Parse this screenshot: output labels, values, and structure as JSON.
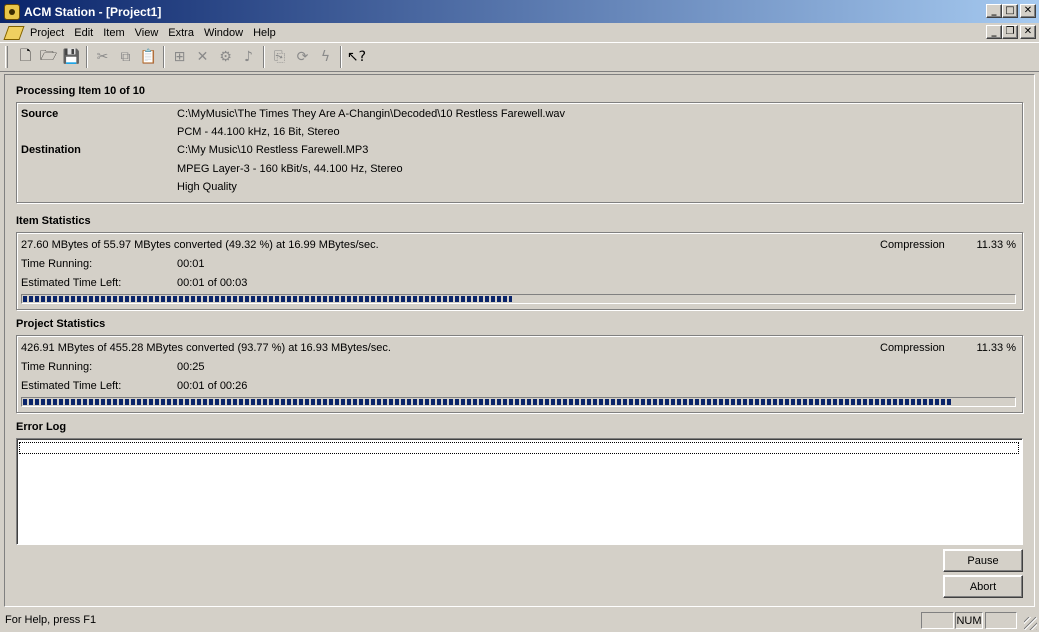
{
  "window": {
    "title": "ACM Station - [Project1]",
    "caption_buttons": {
      "minimize": "_",
      "maximize": "□",
      "close": "✕"
    },
    "mdi_buttons": {
      "minimize": "_",
      "restore": "❐",
      "close": "✕"
    }
  },
  "menu": [
    "Project",
    "Edit",
    "Item",
    "View",
    "Extra",
    "Window",
    "Help"
  ],
  "toolbar": {
    "groups": [
      [
        {
          "icon": "new-file-icon",
          "glyph": "🗋",
          "enabled": true
        },
        {
          "icon": "open-folder-icon",
          "glyph": "🗁",
          "enabled": true
        },
        {
          "icon": "save-disk-icon",
          "glyph": "💾",
          "enabled": true
        }
      ],
      [
        {
          "icon": "cut-icon",
          "glyph": "✂",
          "enabled": false
        },
        {
          "icon": "copy-icon",
          "glyph": "⧉",
          "enabled": false
        },
        {
          "icon": "paste-icon",
          "glyph": "📋",
          "enabled": false
        }
      ],
      [
        {
          "icon": "add-item-icon",
          "glyph": "⊞",
          "enabled": false
        },
        {
          "icon": "delete-icon",
          "glyph": "✕",
          "enabled": false
        },
        {
          "icon": "properties-icon",
          "glyph": "⚙",
          "enabled": false
        },
        {
          "icon": "music-note-icon",
          "glyph": "♪",
          "enabled": false
        }
      ],
      [
        {
          "icon": "copy-settings-icon",
          "glyph": "⎘",
          "enabled": false
        },
        {
          "icon": "convert-icon",
          "glyph": "⟳",
          "enabled": false
        },
        {
          "icon": "lightning-icon",
          "glyph": "ϟ",
          "enabled": false
        }
      ],
      [
        {
          "icon": "context-help-icon",
          "glyph": "↖?",
          "enabled": true
        }
      ]
    ]
  },
  "processing": {
    "heading": "Processing Item 10 of 10",
    "source_label": "Source",
    "source_path": "C:\\MyMusic\\The Times They Are A-Changin\\Decoded\\10 Restless Farewell.wav",
    "source_format": "PCM - 44.100 kHz, 16 Bit, Stereo",
    "destination_label": "Destination",
    "destination_path": "C:\\My Music\\10 Restless Farewell.MP3",
    "destination_format": "MPEG Layer-3 - 160 kBit/s, 44.100 Hz, Stereo",
    "destination_quality": "High Quality"
  },
  "item_stats": {
    "heading": "Item Statistics",
    "converted": "27.60 MBytes of 55.97 MBytes converted (49.32 %) at 16.99 MBytes/sec.",
    "compression_label": "Compression",
    "compression_value": "11.33 %",
    "time_running_label": "Time Running:",
    "time_running": "00:01",
    "eta_label": "Estimated Time Left:",
    "eta": "00:01 of 00:03",
    "progress": 0.4932
  },
  "project_stats": {
    "heading": "Project Statistics",
    "converted": "426.91 MBytes of 455.28 MBytes converted (93.77 %) at 16.93 MBytes/sec.",
    "compression_label": "Compression",
    "compression_value": "11.33 %",
    "time_running_label": "Time Running:",
    "time_running": "00:25",
    "eta_label": "Estimated Time Left:",
    "eta": "00:01 of 00:26",
    "progress": 0.9377
  },
  "error_log": {
    "heading": "Error Log"
  },
  "buttons": {
    "pause": "Pause",
    "abort": "Abort"
  },
  "statusbar": {
    "message": "For Help, press F1",
    "num": "NUM"
  }
}
